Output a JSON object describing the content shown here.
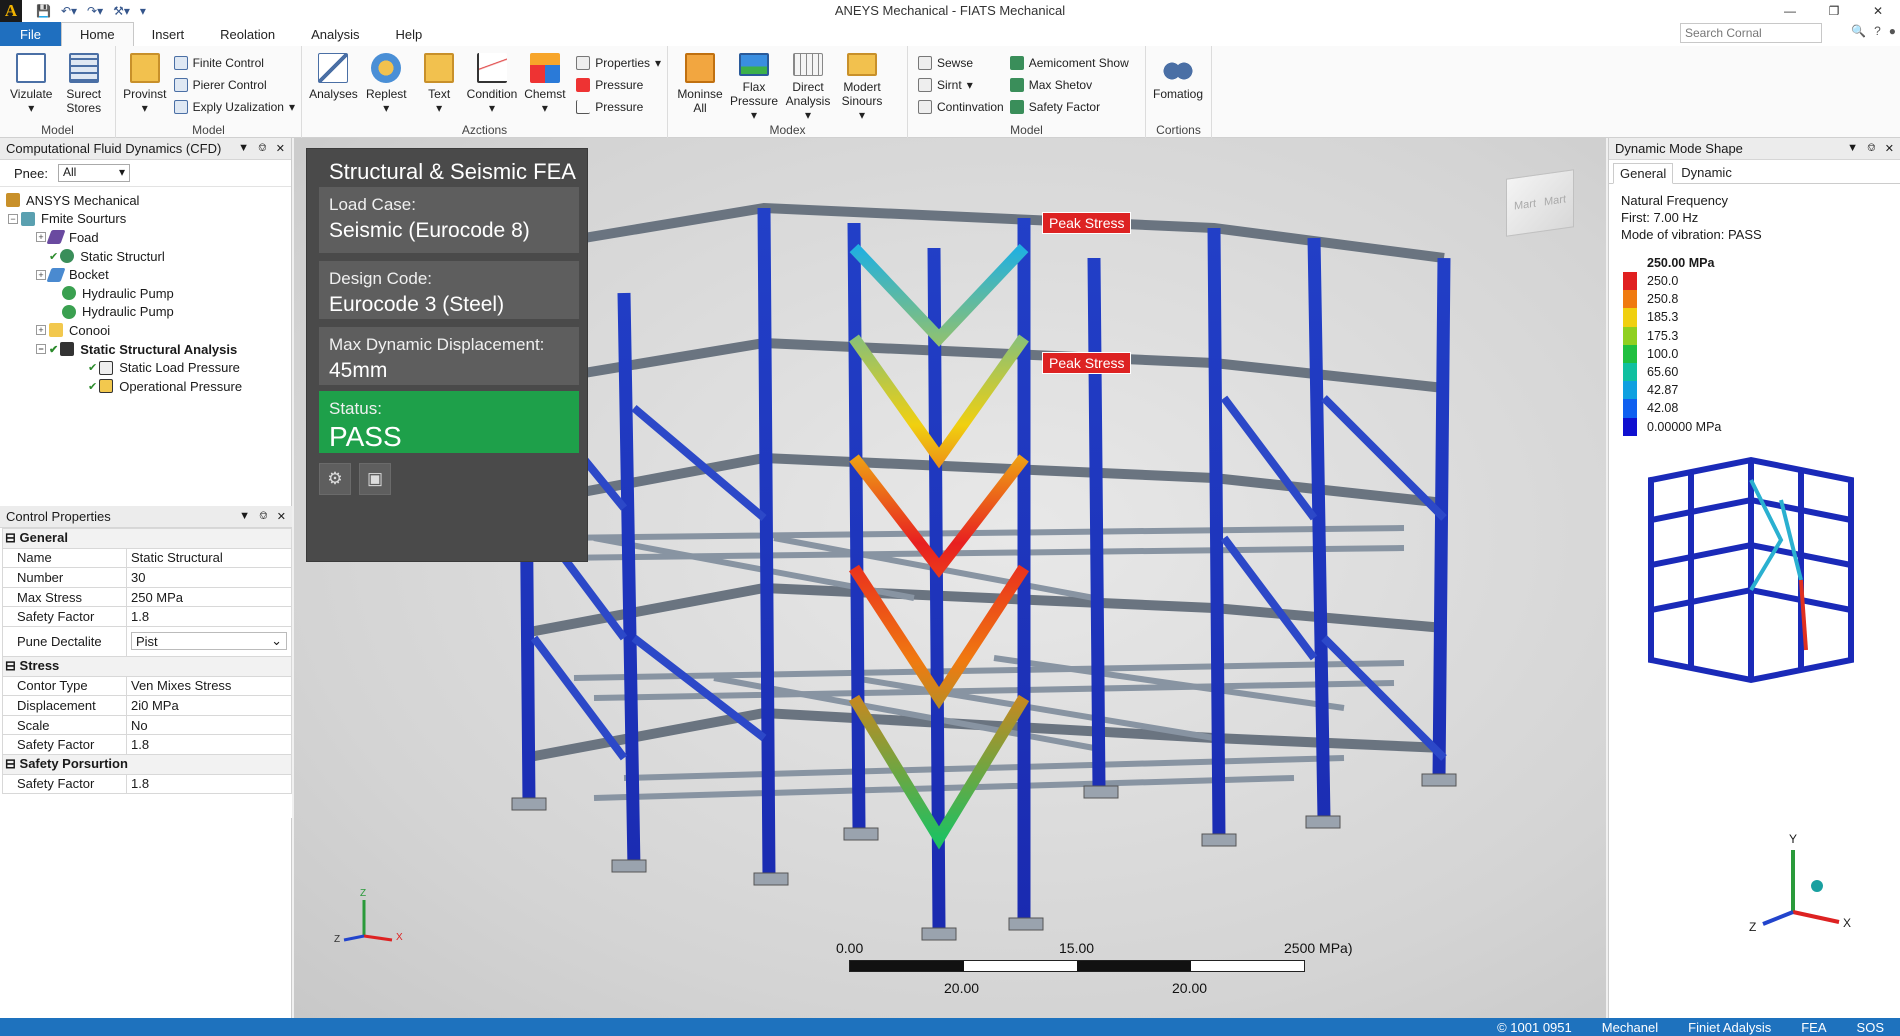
{
  "window": {
    "title": "ANEYS Mechanical - FIATS Mechanical",
    "logo": "A"
  },
  "menu": {
    "tabs": [
      "File",
      "Home",
      "Insert",
      "Reolation",
      "Analysis",
      "Help"
    ],
    "active": "Home",
    "search_placeholder": "Search Cornal"
  },
  "ribbon": {
    "groups": [
      {
        "label": "Model",
        "big": [
          "Vizulate",
          "Surect Stores"
        ]
      },
      {
        "label": "Model",
        "big": [
          "Provinst"
        ],
        "small": [
          "Finite Control",
          "Pierer Control",
          "Exply Uzalization"
        ]
      },
      {
        "label": "Azctions",
        "big": [
          "Analyses",
          "Replest",
          "Text",
          "Condition",
          "Chemst"
        ],
        "small": [
          "Properties",
          "Pressure",
          "Pressure"
        ]
      },
      {
        "label": "Modex",
        "big": [
          "Moninse All",
          "Flax Pressure",
          "Direct Analysis",
          "Modert Sinours"
        ]
      },
      {
        "label": "Model",
        "small": [
          "Sewse",
          "Sirnt",
          "Continvation"
        ],
        "small2": [
          "Aemicoment Show",
          "Max Shetov",
          "Safety Factor"
        ]
      },
      {
        "label": "Cortions",
        "big": [
          "Fomatiog"
        ]
      }
    ]
  },
  "tree_panel": {
    "title": "Computational Fluid Dynamics (CFD)",
    "filter_label": "Pnee:",
    "filter_value": "All",
    "items": [
      {
        "label": "ANSYS Mechanical",
        "level": 0
      },
      {
        "label": "Fmite Sourturs",
        "level": 1
      },
      {
        "label": "Foad",
        "level": 2
      },
      {
        "label": "Static Structurl",
        "level": 2
      },
      {
        "label": "Bocket",
        "level": 2
      },
      {
        "label": "Hydraulic Pump",
        "level": 2
      },
      {
        "label": "Hydraulic Pump",
        "level": 2
      },
      {
        "label": "Conooi",
        "level": 2
      },
      {
        "label": "Static Structural Analysis",
        "level": 2
      },
      {
        "label": "Static Load Pressure",
        "level": 3
      },
      {
        "label": "Operational Pressure",
        "level": 3
      }
    ]
  },
  "props_panel": {
    "title": "Control Properties",
    "sections": [
      {
        "name": "General",
        "rows": [
          [
            "Name",
            "Static Structural"
          ],
          [
            "Number",
            "30"
          ],
          [
            "Max Stress",
            "250 MPa"
          ],
          [
            "Safety Factor",
            "1.8"
          ],
          [
            "Pune Dectalite",
            "Pist"
          ]
        ]
      },
      {
        "name": "Stress",
        "rows": [
          [
            "Contor Type",
            "Ven Mixes Stress"
          ],
          [
            "Displacement",
            "2i0 MPa"
          ],
          [
            "Scale",
            "No"
          ],
          [
            "Safety Factor",
            "1.8"
          ]
        ]
      },
      {
        "name": "Safety Porsurtion",
        "rows": [
          [
            "Safety Factor",
            "1.8"
          ]
        ]
      }
    ]
  },
  "info_panel": {
    "title": "Structural & Seismic FEA",
    "load_case_label": "Load Case:",
    "load_case": "Seismic (Eurocode 8)",
    "design_code_label": "Design Code:",
    "design_code": "Eurocode 3 (Steel)",
    "disp_label": "Max Dynamic Displacement:",
    "disp": "45mm",
    "status_label": "Status:",
    "status": "PASS"
  },
  "viewport": {
    "peak_label": "Peak Stress",
    "viewcube_labels": [
      "Mart",
      "Mart"
    ],
    "scale": {
      "min": "0.00",
      "mid": "15.00",
      "max": "2500 MPa)",
      "sub1": "20.00",
      "sub2": "20.00"
    },
    "axes": {
      "x": "X",
      "y": "Y",
      "z": "Z"
    }
  },
  "right_panel": {
    "title": "Dynamic Mode Shape",
    "tabs": [
      "General",
      "Dynamic"
    ],
    "freq_title": "Natural Frequency",
    "freq": "First: 7.00 Hz",
    "mode": "Mode of vibration: PASS",
    "legend_title": "250.00 MPa",
    "legend": [
      {
        "label": "250.0",
        "color": "#e02020"
      },
      {
        "label": "250.8",
        "color": "#f07a10"
      },
      {
        "label": "185.3",
        "color": "#f0d010"
      },
      {
        "label": "175.3",
        "color": "#90d020"
      },
      {
        "label": "100.0",
        "color": "#20c040"
      },
      {
        "label": "65.60",
        "color": "#10c0a0"
      },
      {
        "label": "42.87",
        "color": "#10a0e0"
      },
      {
        "label": "42.08",
        "color": "#1060f0"
      },
      {
        "label": "0.00000 MPa",
        "color": "#1010d0"
      }
    ]
  },
  "status_bar": [
    "© 1001 0951",
    "Mechanel",
    "Finiet Adalysis",
    "FEA",
    "SOS"
  ]
}
